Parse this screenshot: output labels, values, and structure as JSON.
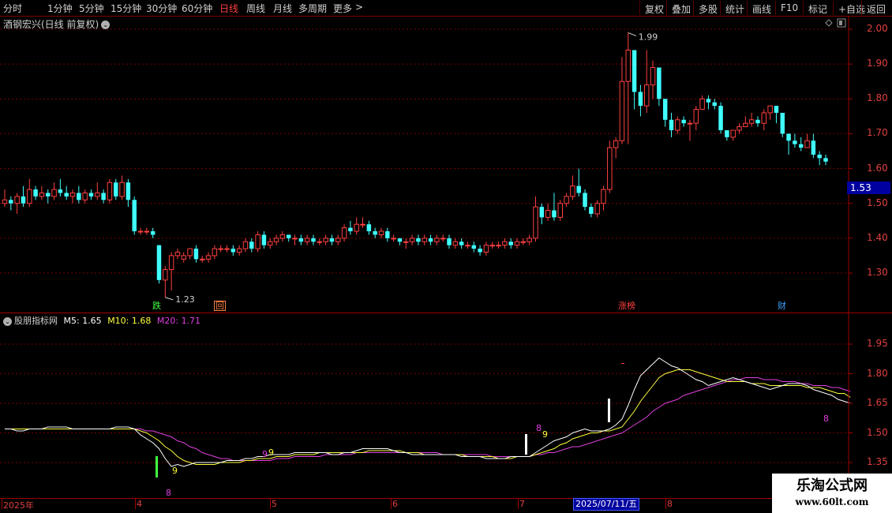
{
  "toolbar": {
    "periods": [
      "分时",
      "1分钟",
      "5分钟",
      "15分钟",
      "30分钟",
      "60分钟",
      "日线",
      "周线",
      "月线",
      "多周期",
      "更多"
    ],
    "active": "日线",
    "more_arrow": ">",
    "right": [
      "复权",
      "叠加",
      "多股",
      "统计",
      "画线",
      "F10",
      "标记",
      "+自选",
      "返回"
    ]
  },
  "stock_title": "酒钢宏兴(日线 前复权)",
  "indicator": {
    "name": "股朋指标网",
    "m5_label": "M5: 1.65",
    "m10_label": "M10: 1.68",
    "m20_label": "M20: 1.71",
    "colors": {
      "m5": "#ffffff",
      "m10": "#ffff40",
      "m20": "#e040e0"
    }
  },
  "price_axis": [
    "2.00",
    "1.90",
    "1.80",
    "1.70",
    "1.60",
    "1.50",
    "1.40",
    "1.30"
  ],
  "current_price": "1.53",
  "indicator_axis": [
    "1.95",
    "1.80",
    "1.65",
    "1.50",
    "1.35"
  ],
  "annotations": {
    "high": "1.99",
    "low": "1.23"
  },
  "event_markers": [
    {
      "label": "跌",
      "color": "#40ff40"
    },
    {
      "label": "回",
      "color": "#ff8040"
    },
    {
      "label": "涨榜",
      "color": "#ff4040"
    },
    {
      "label": "财",
      "color": "#40a0ff"
    }
  ],
  "signals": [
    {
      "label": "9",
      "color": "#ffff40"
    },
    {
      "label": "8",
      "color": "#e040e0"
    },
    {
      "label": "9",
      "color": "#e040e0"
    },
    {
      "label": "9",
      "color": "#ffff40"
    },
    {
      "label": "8",
      "color": "#e040e0"
    },
    {
      "label": "9",
      "color": "#ffff40"
    },
    {
      "label": "8",
      "color": "#e040e0"
    }
  ],
  "date_axis": {
    "labels": [
      "2025年",
      "4",
      "5",
      "6",
      "7",
      "8"
    ],
    "highlight": "2025/07/11/五"
  },
  "watermark": {
    "main": "乐淘公式网",
    "sub": "www.60lt.com"
  },
  "chart_data": {
    "type": "candlestick",
    "y_range": [
      1.2,
      2.05
    ],
    "up_color": "#ff4040",
    "down_color": "#40ffff",
    "candles": [
      [
        1.5,
        1.51,
        1.54,
        1.49
      ],
      [
        1.51,
        1.5,
        1.52,
        1.48
      ],
      [
        1.5,
        1.52,
        1.53,
        1.47
      ],
      [
        1.52,
        1.5,
        1.55,
        1.49
      ],
      [
        1.5,
        1.54,
        1.57,
        1.49
      ],
      [
        1.54,
        1.52,
        1.55,
        1.51
      ],
      [
        1.52,
        1.53,
        1.55,
        1.51
      ],
      [
        1.53,
        1.52,
        1.54,
        1.5
      ],
      [
        1.52,
        1.54,
        1.56,
        1.51
      ],
      [
        1.54,
        1.53,
        1.57,
        1.52
      ],
      [
        1.53,
        1.52,
        1.55,
        1.51
      ],
      [
        1.52,
        1.53,
        1.54,
        1.5
      ],
      [
        1.53,
        1.51,
        1.55,
        1.5
      ],
      [
        1.51,
        1.53,
        1.54,
        1.5
      ],
      [
        1.53,
        1.52,
        1.54,
        1.51
      ],
      [
        1.52,
        1.53,
        1.56,
        1.51
      ],
      [
        1.53,
        1.51,
        1.54,
        1.5
      ],
      [
        1.51,
        1.56,
        1.57,
        1.5
      ],
      [
        1.56,
        1.52,
        1.57,
        1.51
      ],
      [
        1.52,
        1.56,
        1.58,
        1.51
      ],
      [
        1.56,
        1.51,
        1.57,
        1.49
      ],
      [
        1.51,
        1.42,
        1.52,
        1.41
      ],
      [
        1.42,
        1.42,
        1.43,
        1.41
      ],
      [
        1.42,
        1.42,
        1.43,
        1.41
      ],
      [
        1.42,
        1.41,
        1.43,
        1.4
      ],
      [
        1.38,
        1.28,
        1.38,
        1.27
      ],
      [
        1.28,
        1.31,
        1.32,
        1.23
      ],
      [
        1.31,
        1.35,
        1.36,
        1.25
      ],
      [
        1.35,
        1.36,
        1.37,
        1.34
      ],
      [
        1.34,
        1.35,
        1.36,
        1.33
      ],
      [
        1.35,
        1.37,
        1.37,
        1.34
      ],
      [
        1.37,
        1.34,
        1.38,
        1.33
      ],
      [
        1.34,
        1.34,
        1.35,
        1.33
      ],
      [
        1.34,
        1.35,
        1.36,
        1.33
      ],
      [
        1.35,
        1.37,
        1.38,
        1.34
      ],
      [
        1.37,
        1.37,
        1.38,
        1.36
      ],
      [
        1.37,
        1.37,
        1.38,
        1.36
      ],
      [
        1.37,
        1.36,
        1.38,
        1.35
      ],
      [
        1.36,
        1.37,
        1.38,
        1.35
      ],
      [
        1.37,
        1.39,
        1.4,
        1.36
      ],
      [
        1.39,
        1.37,
        1.4,
        1.36
      ],
      [
        1.37,
        1.41,
        1.42,
        1.36
      ],
      [
        1.41,
        1.38,
        1.42,
        1.37
      ],
      [
        1.38,
        1.39,
        1.4,
        1.37
      ],
      [
        1.39,
        1.4,
        1.41,
        1.38
      ],
      [
        1.4,
        1.41,
        1.42,
        1.39
      ],
      [
        1.41,
        1.4,
        1.41,
        1.39
      ],
      [
        1.4,
        1.4,
        1.41,
        1.38
      ],
      [
        1.4,
        1.39,
        1.41,
        1.38
      ],
      [
        1.39,
        1.4,
        1.41,
        1.38
      ],
      [
        1.4,
        1.39,
        1.41,
        1.38
      ],
      [
        1.39,
        1.39,
        1.4,
        1.38
      ],
      [
        1.39,
        1.4,
        1.41,
        1.38
      ],
      [
        1.4,
        1.39,
        1.41,
        1.38
      ],
      [
        1.39,
        1.4,
        1.41,
        1.38
      ],
      [
        1.4,
        1.43,
        1.44,
        1.39
      ],
      [
        1.43,
        1.42,
        1.45,
        1.41
      ],
      [
        1.42,
        1.44,
        1.46,
        1.41
      ],
      [
        1.44,
        1.44,
        1.46,
        1.43
      ],
      [
        1.44,
        1.42,
        1.45,
        1.41
      ],
      [
        1.42,
        1.41,
        1.43,
        1.4
      ],
      [
        1.41,
        1.42,
        1.43,
        1.4
      ],
      [
        1.42,
        1.4,
        1.43,
        1.39
      ],
      [
        1.4,
        1.4,
        1.41,
        1.39
      ],
      [
        1.4,
        1.39,
        1.4,
        1.38
      ],
      [
        1.39,
        1.39,
        1.4,
        1.37
      ],
      [
        1.39,
        1.4,
        1.41,
        1.38
      ],
      [
        1.4,
        1.39,
        1.41,
        1.38
      ],
      [
        1.39,
        1.4,
        1.41,
        1.38
      ],
      [
        1.4,
        1.39,
        1.41,
        1.38
      ],
      [
        1.39,
        1.4,
        1.41,
        1.38
      ],
      [
        1.4,
        1.4,
        1.41,
        1.39
      ],
      [
        1.4,
        1.38,
        1.41,
        1.37
      ],
      [
        1.38,
        1.39,
        1.4,
        1.37
      ],
      [
        1.39,
        1.38,
        1.4,
        1.37
      ],
      [
        1.38,
        1.38,
        1.39,
        1.37
      ],
      [
        1.38,
        1.37,
        1.39,
        1.36
      ],
      [
        1.37,
        1.36,
        1.38,
        1.35
      ],
      [
        1.36,
        1.38,
        1.39,
        1.35
      ],
      [
        1.38,
        1.38,
        1.39,
        1.37
      ],
      [
        1.38,
        1.38,
        1.39,
        1.37
      ],
      [
        1.38,
        1.39,
        1.4,
        1.37
      ],
      [
        1.39,
        1.38,
        1.4,
        1.37
      ],
      [
        1.38,
        1.39,
        1.4,
        1.37
      ],
      [
        1.39,
        1.39,
        1.4,
        1.38
      ],
      [
        1.39,
        1.4,
        1.41,
        1.38
      ],
      [
        1.4,
        1.49,
        1.52,
        1.39
      ],
      [
        1.49,
        1.46,
        1.5,
        1.44
      ],
      [
        1.46,
        1.48,
        1.5,
        1.45
      ],
      [
        1.48,
        1.46,
        1.53,
        1.45
      ],
      [
        1.46,
        1.5,
        1.51,
        1.45
      ],
      [
        1.5,
        1.52,
        1.53,
        1.49
      ],
      [
        1.52,
        1.55,
        1.58,
        1.51
      ],
      [
        1.55,
        1.53,
        1.6,
        1.52
      ],
      [
        1.53,
        1.49,
        1.54,
        1.48
      ],
      [
        1.49,
        1.47,
        1.5,
        1.46
      ],
      [
        1.47,
        1.5,
        1.51,
        1.46
      ],
      [
        1.5,
        1.54,
        1.55,
        1.48
      ],
      [
        1.54,
        1.66,
        1.68,
        1.53
      ],
      [
        1.66,
        1.68,
        1.69,
        1.63
      ],
      [
        1.68,
        1.85,
        1.92,
        1.67
      ],
      [
        1.85,
        1.94,
        1.99,
        1.67
      ],
      [
        1.94,
        1.82,
        1.94,
        1.77
      ],
      [
        1.82,
        1.78,
        1.84,
        1.75
      ],
      [
        1.78,
        1.84,
        1.94,
        1.76
      ],
      [
        1.84,
        1.89,
        1.91,
        1.8
      ],
      [
        1.89,
        1.8,
        1.87,
        1.78
      ],
      [
        1.8,
        1.74,
        1.8,
        1.72
      ],
      [
        1.74,
        1.71,
        1.76,
        1.69
      ],
      [
        1.71,
        1.74,
        1.75,
        1.7
      ],
      [
        1.74,
        1.73,
        1.75,
        1.72
      ],
      [
        1.73,
        1.73,
        1.74,
        1.68
      ],
      [
        1.73,
        1.77,
        1.78,
        1.71
      ],
      [
        1.77,
        1.8,
        1.81,
        1.77
      ],
      [
        1.8,
        1.79,
        1.81,
        1.77
      ],
      [
        1.79,
        1.78,
        1.8,
        1.77
      ],
      [
        1.78,
        1.71,
        1.79,
        1.7
      ],
      [
        1.71,
        1.69,
        1.71,
        1.68
      ],
      [
        1.69,
        1.71,
        1.71,
        1.68
      ],
      [
        1.71,
        1.72,
        1.73,
        1.7
      ],
      [
        1.72,
        1.73,
        1.75,
        1.72
      ],
      [
        1.73,
        1.74,
        1.76,
        1.72
      ],
      [
        1.74,
        1.73,
        1.75,
        1.72
      ],
      [
        1.73,
        1.76,
        1.77,
        1.71
      ],
      [
        1.76,
        1.78,
        1.78,
        1.74
      ],
      [
        1.78,
        1.76,
        1.78,
        1.73
      ],
      [
        1.76,
        1.7,
        1.76,
        1.69
      ],
      [
        1.7,
        1.68,
        1.7,
        1.64
      ],
      [
        1.68,
        1.67,
        1.7,
        1.66
      ],
      [
        1.67,
        1.66,
        1.69,
        1.65
      ],
      [
        1.66,
        1.68,
        1.7,
        1.66
      ],
      [
        1.68,
        1.64,
        1.7,
        1.63
      ],
      [
        1.64,
        1.63,
        1.65,
        1.61
      ],
      [
        1.63,
        1.62,
        1.64,
        1.61
      ]
    ],
    "indicator_y_range": [
      1.28,
      2.05
    ],
    "m5": [
      1.52,
      1.52,
      1.51,
      1.51,
      1.52,
      1.52,
      1.52,
      1.53,
      1.53,
      1.53,
      1.53,
      1.52,
      1.52,
      1.52,
      1.52,
      1.52,
      1.52,
      1.52,
      1.53,
      1.53,
      1.53,
      1.52,
      1.49,
      1.47,
      1.45,
      1.42,
      1.37,
      1.33,
      1.34,
      1.33,
      1.34,
      1.35,
      1.35,
      1.35,
      1.35,
      1.35,
      1.36,
      1.36,
      1.36,
      1.37,
      1.37,
      1.38,
      1.38,
      1.39,
      1.39,
      1.39,
      1.39,
      1.4,
      1.4,
      1.4,
      1.4,
      1.4,
      1.4,
      1.39,
      1.39,
      1.4,
      1.4,
      1.41,
      1.42,
      1.42,
      1.42,
      1.42,
      1.42,
      1.41,
      1.4,
      1.4,
      1.39,
      1.39,
      1.39,
      1.39,
      1.39,
      1.39,
      1.39,
      1.39,
      1.38,
      1.38,
      1.38,
      1.38,
      1.37,
      1.37,
      1.37,
      1.37,
      1.38,
      1.38,
      1.38,
      1.38,
      1.4,
      1.42,
      1.44,
      1.46,
      1.47,
      1.48,
      1.5,
      1.51,
      1.52,
      1.51,
      1.51,
      1.51,
      1.52,
      1.54,
      1.57,
      1.64,
      1.72,
      1.79,
      1.82,
      1.85,
      1.88,
      1.86,
      1.84,
      1.83,
      1.81,
      1.79,
      1.77,
      1.76,
      1.74,
      1.75,
      1.76,
      1.77,
      1.78,
      1.77,
      1.76,
      1.75,
      1.74,
      1.73,
      1.72,
      1.73,
      1.74,
      1.75,
      1.75,
      1.75,
      1.74,
      1.72,
      1.71,
      1.7,
      1.69,
      1.67,
      1.66,
      1.65
    ],
    "m10": [
      1.52,
      1.52,
      1.52,
      1.52,
      1.52,
      1.52,
      1.52,
      1.52,
      1.52,
      1.52,
      1.52,
      1.52,
      1.52,
      1.52,
      1.52,
      1.52,
      1.52,
      1.52,
      1.52,
      1.52,
      1.52,
      1.52,
      1.51,
      1.5,
      1.48,
      1.46,
      1.43,
      1.41,
      1.38,
      1.36,
      1.35,
      1.34,
      1.34,
      1.34,
      1.34,
      1.35,
      1.35,
      1.35,
      1.35,
      1.36,
      1.36,
      1.37,
      1.37,
      1.37,
      1.38,
      1.38,
      1.38,
      1.39,
      1.39,
      1.39,
      1.39,
      1.4,
      1.4,
      1.4,
      1.4,
      1.4,
      1.4,
      1.4,
      1.4,
      1.41,
      1.41,
      1.41,
      1.41,
      1.41,
      1.41,
      1.4,
      1.4,
      1.4,
      1.39,
      1.39,
      1.39,
      1.39,
      1.39,
      1.39,
      1.39,
      1.38,
      1.38,
      1.38,
      1.38,
      1.38,
      1.37,
      1.37,
      1.37,
      1.38,
      1.38,
      1.38,
      1.39,
      1.4,
      1.41,
      1.42,
      1.44,
      1.45,
      1.47,
      1.48,
      1.49,
      1.5,
      1.5,
      1.51,
      1.51,
      1.52,
      1.53,
      1.57,
      1.61,
      1.66,
      1.7,
      1.74,
      1.78,
      1.8,
      1.81,
      1.82,
      1.82,
      1.82,
      1.81,
      1.8,
      1.79,
      1.78,
      1.77,
      1.76,
      1.76,
      1.76,
      1.76,
      1.75,
      1.75,
      1.75,
      1.74,
      1.74,
      1.74,
      1.74,
      1.74,
      1.74,
      1.73,
      1.73,
      1.73,
      1.72,
      1.71,
      1.7,
      1.7,
      1.68
    ],
    "m20": [
      1.52,
      1.52,
      1.52,
      1.52,
      1.52,
      1.52,
      1.52,
      1.52,
      1.52,
      1.52,
      1.52,
      1.52,
      1.52,
      1.52,
      1.52,
      1.52,
      1.52,
      1.52,
      1.52,
      1.52,
      1.52,
      1.52,
      1.52,
      1.51,
      1.51,
      1.5,
      1.49,
      1.48,
      1.46,
      1.45,
      1.43,
      1.42,
      1.4,
      1.39,
      1.38,
      1.37,
      1.37,
      1.36,
      1.36,
      1.36,
      1.36,
      1.36,
      1.36,
      1.36,
      1.37,
      1.37,
      1.37,
      1.38,
      1.38,
      1.38,
      1.38,
      1.38,
      1.39,
      1.39,
      1.39,
      1.39,
      1.39,
      1.4,
      1.4,
      1.4,
      1.4,
      1.4,
      1.4,
      1.4,
      1.4,
      1.4,
      1.4,
      1.4,
      1.4,
      1.4,
      1.4,
      1.39,
      1.39,
      1.39,
      1.39,
      1.39,
      1.39,
      1.39,
      1.39,
      1.38,
      1.38,
      1.38,
      1.38,
      1.38,
      1.38,
      1.38,
      1.39,
      1.39,
      1.4,
      1.4,
      1.41,
      1.42,
      1.43,
      1.43,
      1.44,
      1.45,
      1.46,
      1.47,
      1.48,
      1.49,
      1.5,
      1.52,
      1.54,
      1.56,
      1.58,
      1.61,
      1.63,
      1.65,
      1.66,
      1.67,
      1.69,
      1.7,
      1.71,
      1.72,
      1.73,
      1.74,
      1.75,
      1.76,
      1.77,
      1.77,
      1.78,
      1.78,
      1.78,
      1.77,
      1.77,
      1.77,
      1.76,
      1.76,
      1.76,
      1.75,
      1.75,
      1.74,
      1.74,
      1.74,
      1.73,
      1.73,
      1.72,
      1.71
    ]
  }
}
